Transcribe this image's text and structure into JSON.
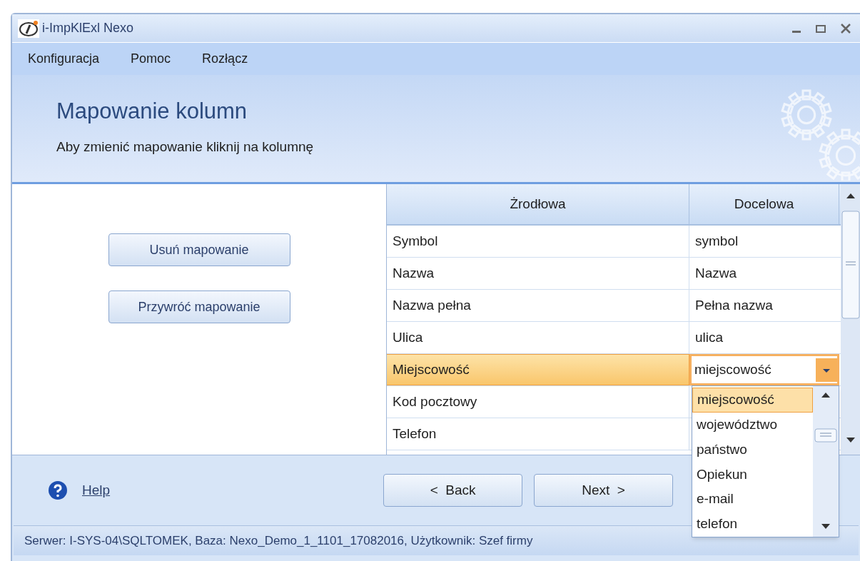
{
  "window": {
    "title": "i-ImpKlExl Nexo"
  },
  "menu": [
    "Konfiguracja",
    "Pomoc",
    "Rozłącz"
  ],
  "header": {
    "title": "Mapowanie kolumn",
    "subtitle": "Aby zmienić mapowanie kliknij na kolumnę"
  },
  "actions": [
    "Usuń mapowanie",
    "Przywróć mapowanie"
  ],
  "table": {
    "columns": [
      "Żrodłowa",
      "Docelowa"
    ],
    "rows": [
      {
        "source": "Symbol",
        "target": "symbol",
        "selected": false
      },
      {
        "source": "Nazwa",
        "target": "Nazwa",
        "selected": false
      },
      {
        "source": "Nazwa pełna",
        "target": "Pełna nazwa",
        "selected": false
      },
      {
        "source": "Ulica",
        "target": "ulica",
        "selected": false
      },
      {
        "source": "Miejscowość",
        "target": "miejscowość",
        "selected": true
      },
      {
        "source": "Kod pocztowy",
        "selected": false
      },
      {
        "source": "Telefon",
        "selected": false
      }
    ]
  },
  "dropdown": {
    "options": [
      {
        "label": "miejscowość",
        "selected": true
      },
      {
        "label": "województwo",
        "selected": false
      },
      {
        "label": "państwo",
        "selected": false
      },
      {
        "label": "Opiekun",
        "selected": false
      },
      {
        "label": "e-mail",
        "selected": false
      },
      {
        "label": "telefon",
        "selected": false
      }
    ]
  },
  "footer": {
    "help": "Help",
    "back": "<  Back",
    "next": "Next  >"
  },
  "status_bar": "Serwer: I-SYS-04\\SQLTOMEK, Baza: Nexo_Demo_1_1101_17082016, Użytkownik: Szef firmy"
}
